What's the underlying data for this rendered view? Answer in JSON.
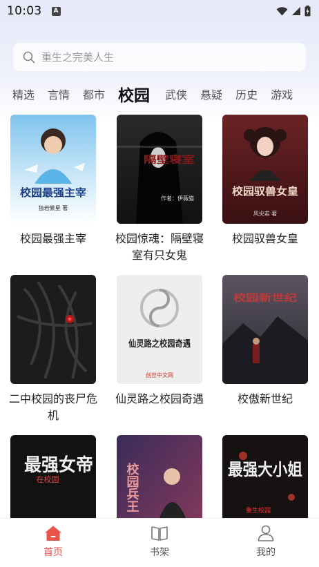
{
  "status_bar": {
    "time": "10:03",
    "notification": "A"
  },
  "search": {
    "placeholder": "重生之完美人生"
  },
  "tabs": [
    {
      "label": "精选"
    },
    {
      "label": "言情"
    },
    {
      "label": "都市"
    },
    {
      "label": "校园",
      "active": true
    },
    {
      "label": "武侠"
    },
    {
      "label": "悬疑"
    },
    {
      "label": "历史"
    },
    {
      "label": "游戏"
    }
  ],
  "books": [
    {
      "title": "校园最强主宰",
      "cover_text": "校园最强主宰",
      "cover_author": "独若繁星 著"
    },
    {
      "title": "校园惊魂：隔壁寝室有只女鬼",
      "cover_text": "隔壁寝室",
      "cover_author": "作者：伊薇猫"
    },
    {
      "title": "校园驭兽女皇",
      "cover_text": "校园驭兽女皇",
      "cover_author": "风尖若 著"
    },
    {
      "title": "二中校园的丧尸危机",
      "cover_text": ""
    },
    {
      "title": "仙灵路之校园奇遇",
      "cover_text": "仙灵路之校园奇遇",
      "cover_author": "创世中文网"
    },
    {
      "title": "校傲新世纪",
      "cover_text": "校园新世纪"
    },
    {
      "title": "",
      "cover_text": "最强女帝",
      "cover_sub": "在校园"
    },
    {
      "title": "",
      "cover_text": "校园兵王"
    },
    {
      "title": "",
      "cover_text": "最强大小姐",
      "cover_sub": "重生校园"
    }
  ],
  "bottom_nav": [
    {
      "label": "首页",
      "icon": "home-icon",
      "active": true
    },
    {
      "label": "书架",
      "icon": "bookshelf-icon"
    },
    {
      "label": "我的",
      "icon": "profile-icon"
    }
  ],
  "colors": {
    "accent": "#e8534a"
  }
}
